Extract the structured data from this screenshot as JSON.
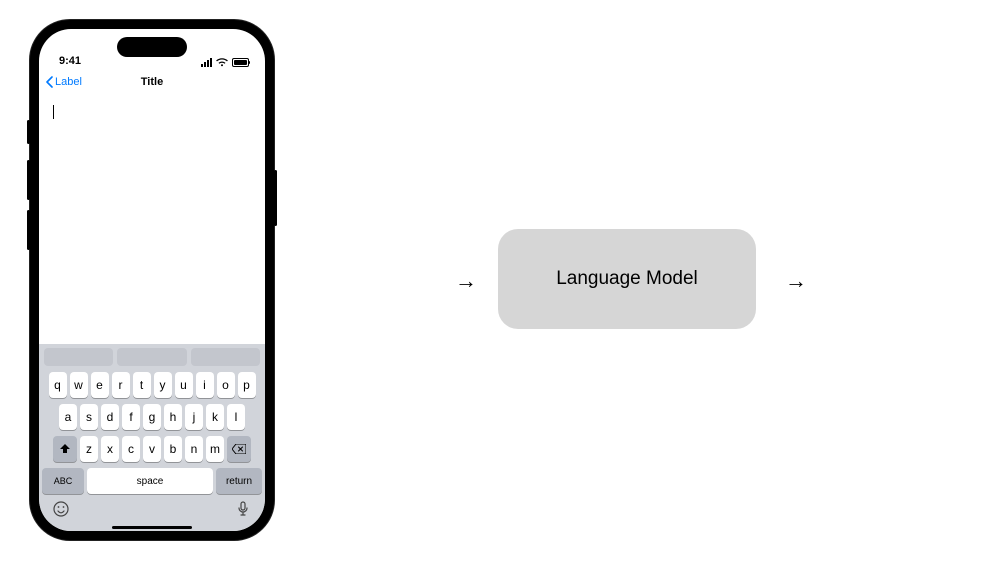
{
  "phone": {
    "status": {
      "time": "9:41"
    },
    "nav": {
      "back_label": "Label",
      "title": "Title"
    },
    "input": {
      "value": ""
    },
    "keyboard": {
      "row1": [
        "q",
        "w",
        "e",
        "r",
        "t",
        "y",
        "u",
        "i",
        "o",
        "p"
      ],
      "row2": [
        "a",
        "s",
        "d",
        "f",
        "g",
        "h",
        "j",
        "k",
        "l"
      ],
      "row3": [
        "z",
        "x",
        "c",
        "v",
        "b",
        "n",
        "m"
      ],
      "abc_label": "ABC",
      "space_label": "space",
      "return_label": "return"
    }
  },
  "diagram": {
    "box_label": "Language Model",
    "arrow_glyph": "→"
  }
}
